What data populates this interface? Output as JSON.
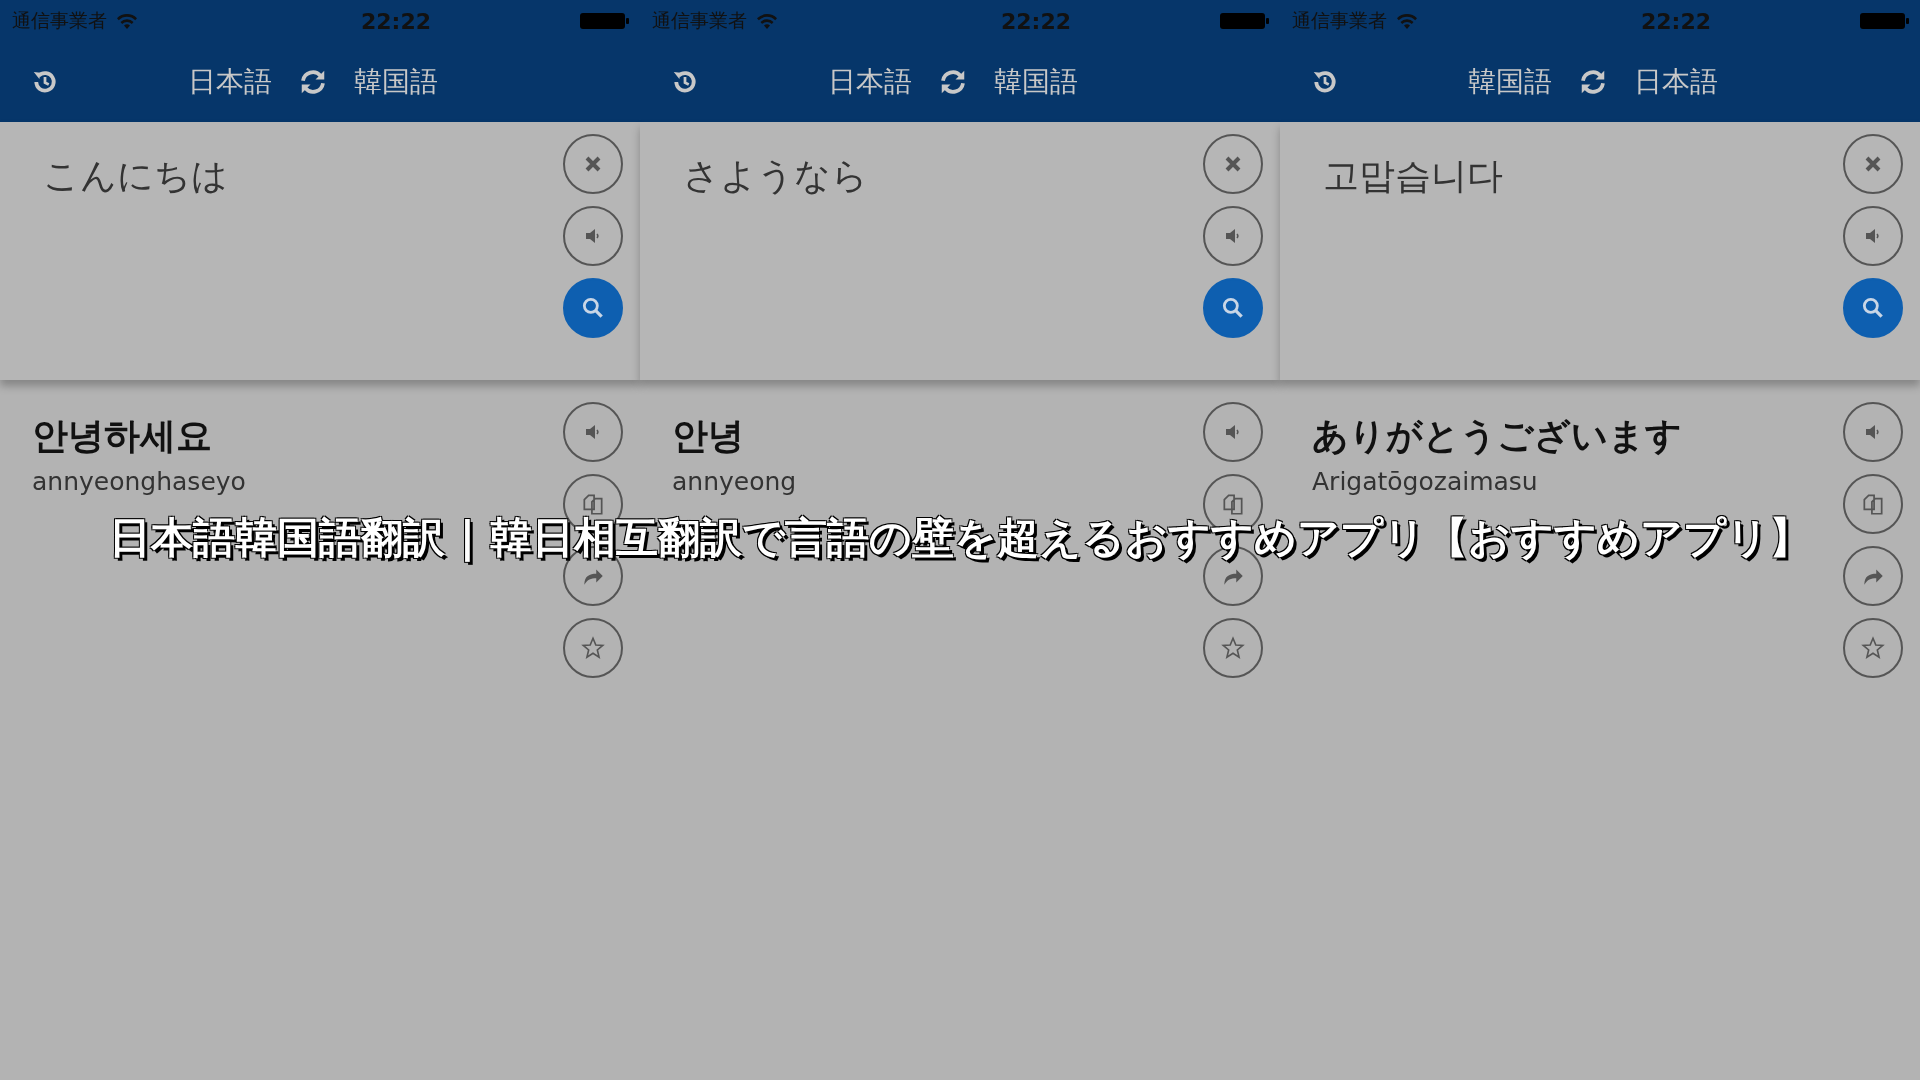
{
  "panels": [
    {
      "status": {
        "carrier": "通信事業者",
        "time": "22:22"
      },
      "source_lang": "日本語",
      "target_lang": "韓国語",
      "input_text": "こんにちは",
      "result_text": "안녕하세요",
      "romanization": "annyeonghaseyo"
    },
    {
      "status": {
        "carrier": "通信事業者",
        "time": "22:22"
      },
      "source_lang": "日本語",
      "target_lang": "韓国語",
      "input_text": "さようなら",
      "result_text": "안녕",
      "romanization": "annyeong"
    },
    {
      "status": {
        "carrier": "通信事業者",
        "time": "22:22"
      },
      "source_lang": "韓国語",
      "target_lang": "日本語",
      "input_text": "고맙습니다",
      "result_text": "ありがとうございます",
      "romanization": "Arigatōgozaimasu"
    }
  ],
  "caption": "日本語韓国語翻訳 | 韓日相互翻訳で言語の壁を超えるおすすめアプリ【おすすめアプリ】"
}
